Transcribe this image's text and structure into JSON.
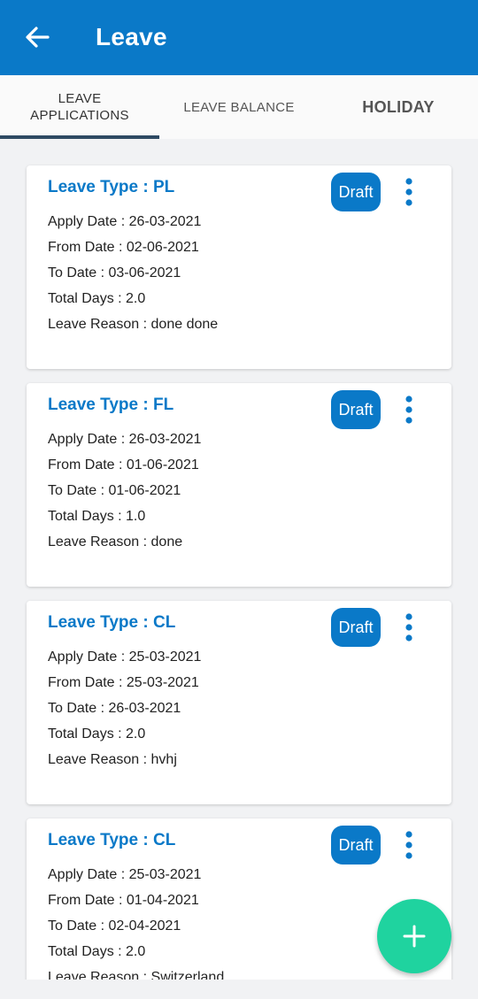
{
  "appbar": {
    "title": "Leave",
    "back_icon": "back-arrow-icon"
  },
  "tabs": [
    {
      "label": "LEAVE APPLICATIONS",
      "selected": true
    },
    {
      "label": "LEAVE BALANCE",
      "selected": false
    },
    {
      "label": "HOLIDAY",
      "selected": false
    }
  ],
  "colors": {
    "primary": "#0a79c8",
    "fab": "#1fd39f",
    "tab_indicator": "#2e4a63"
  },
  "applications": [
    {
      "leave_type": "Leave Type : PL",
      "status": "Draft",
      "apply_date": "Apply Date : 26-03-2021",
      "from_date": "From Date : 02-06-2021",
      "to_date": "To Date : 03-06-2021",
      "total_days": "Total Days : 2.0",
      "reason": "Leave Reason : done done"
    },
    {
      "leave_type": "Leave Type : FL",
      "status": "Draft",
      "apply_date": "Apply Date : 26-03-2021",
      "from_date": "From Date : 01-06-2021",
      "to_date": "To Date : 01-06-2021",
      "total_days": "Total Days : 1.0",
      "reason": "Leave Reason : done"
    },
    {
      "leave_type": "Leave Type : CL",
      "status": "Draft",
      "apply_date": "Apply Date : 25-03-2021",
      "from_date": "From Date : 25-03-2021",
      "to_date": "To Date : 26-03-2021",
      "total_days": "Total Days : 2.0",
      "reason": "Leave Reason : hvhj"
    },
    {
      "leave_type": "Leave Type : CL",
      "status": "Draft",
      "apply_date": "Apply Date : 25-03-2021",
      "from_date": "From Date : 01-04-2021",
      "to_date": "To Date : 02-04-2021",
      "total_days": "Total Days : 2.0",
      "reason": "Leave Reason : Switzerland"
    }
  ],
  "fab": {
    "icon": "plus-icon"
  }
}
